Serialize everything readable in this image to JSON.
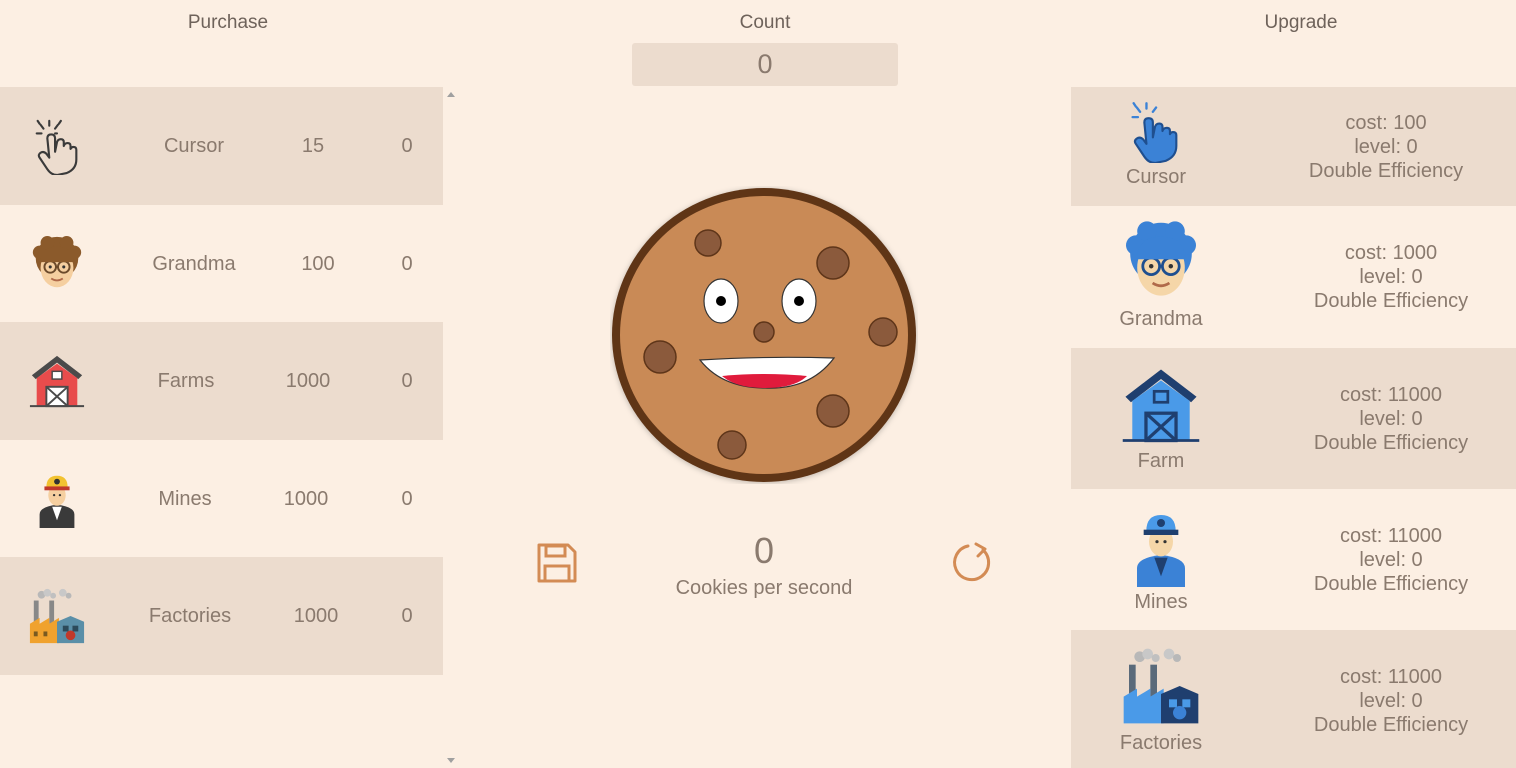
{
  "headers": {
    "purchase": "Purchase",
    "count": "Count",
    "upgrade": "Upgrade"
  },
  "count_value": "0",
  "cps": {
    "value": "0",
    "label": "Cookies per second"
  },
  "purchase_items": [
    {
      "name": "Cursor",
      "cost": "15",
      "owned": "0",
      "icon": "cursor-icon"
    },
    {
      "name": "Grandma",
      "cost": "100",
      "owned": "0",
      "icon": "grandma-icon"
    },
    {
      "name": "Farms",
      "cost": "1000",
      "owned": "0",
      "icon": "farm-icon"
    },
    {
      "name": "Mines",
      "cost": "1000",
      "owned": "0",
      "icon": "miner-icon"
    },
    {
      "name": "Factories",
      "cost": "1000",
      "owned": "0",
      "icon": "factory-icon"
    }
  ],
  "upgrade_items": [
    {
      "name": "Cursor",
      "cost": "cost: 100",
      "level": "level: 0",
      "effect": "Double Efficiency",
      "icon": "cursor-icon"
    },
    {
      "name": "Grandma",
      "cost": "cost: 1000",
      "level": "level: 0",
      "effect": "Double Efficiency",
      "icon": "grandma-icon"
    },
    {
      "name": "Farm",
      "cost": "cost: 11000",
      "level": "level: 0",
      "effect": "Double Efficiency",
      "icon": "farm-icon"
    },
    {
      "name": "Mines",
      "cost": "cost: 11000",
      "level": "level: 0",
      "effect": "Double Efficiency",
      "icon": "miner-icon"
    },
    {
      "name": "Factories",
      "cost": "cost: 11000",
      "level": "level: 0",
      "effect": "Double Efficiency",
      "icon": "factory-icon"
    }
  ],
  "colors": {
    "background": "#fcefe3",
    "row_shade": "#ecdcce",
    "text": "#8a7a6e",
    "accent": "#d38b54",
    "cookie": "#c98a56",
    "cookie_rim": "#5e3519"
  }
}
